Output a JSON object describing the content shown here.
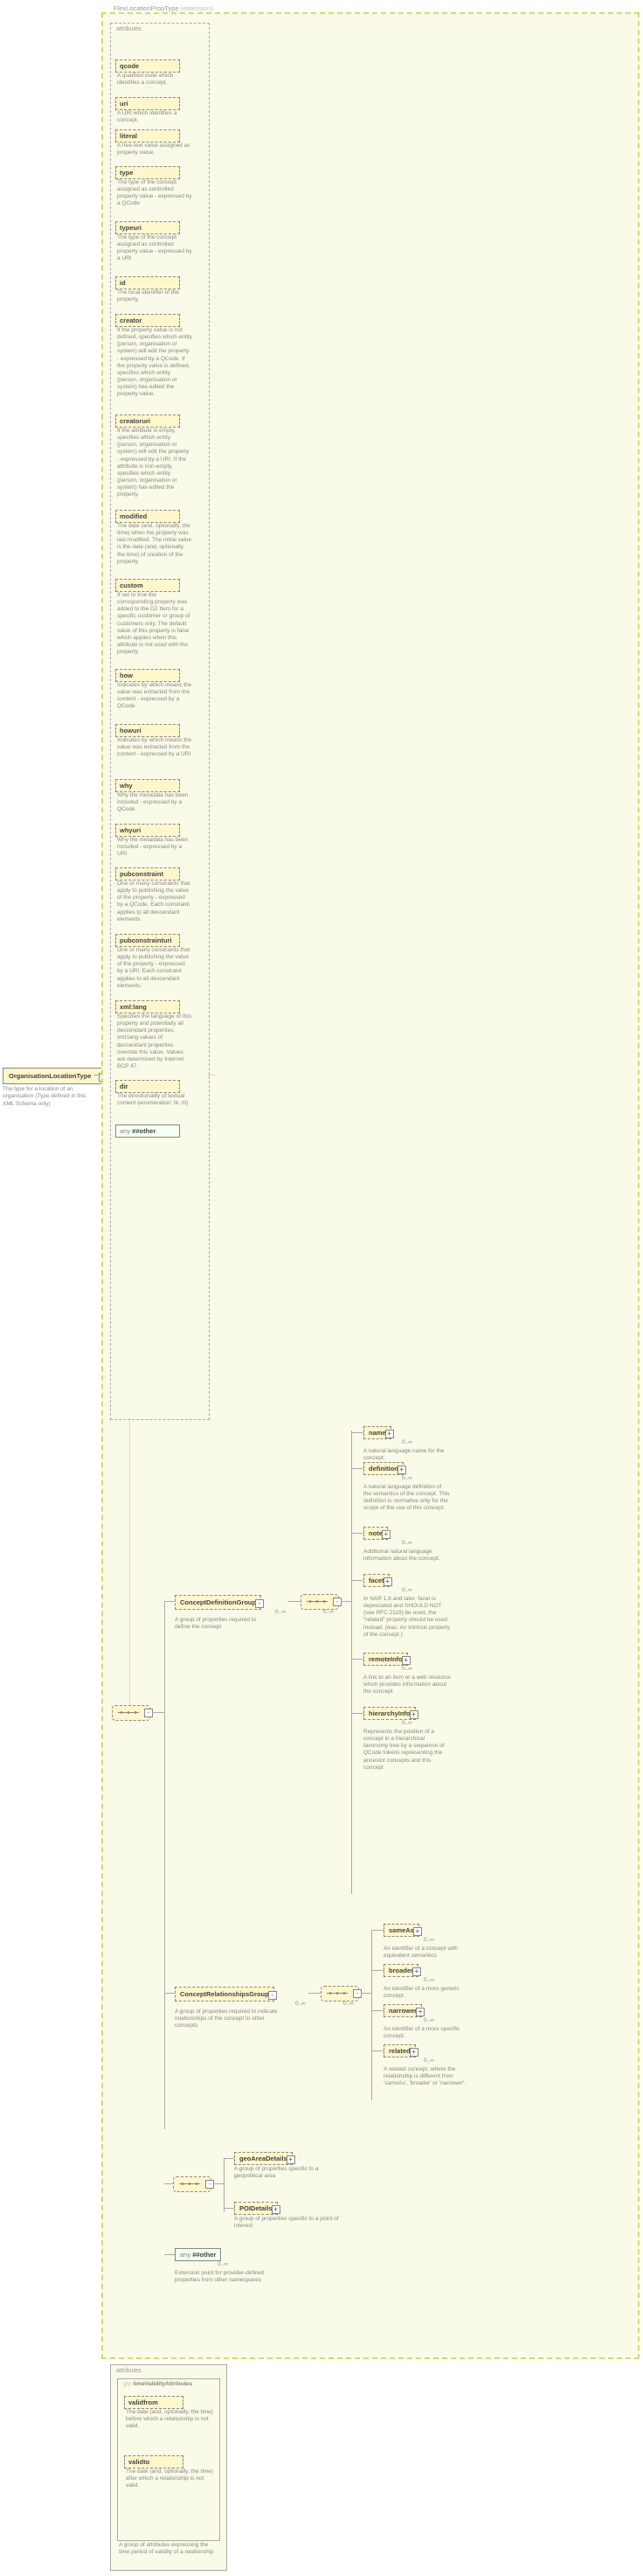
{
  "panel": {
    "title": "FlexLocationPropType",
    "ext": "(extension)"
  },
  "attributes_label": "attributes",
  "root": {
    "name": "OrganisationLocationType",
    "desc": "The type for a location of an organisation (Type defined in this XML Schema only)"
  },
  "attrs": [
    {
      "name": "qcode",
      "desc": "A qualified code which identifies a concept."
    },
    {
      "name": "uri",
      "desc": "A URI which identifies a concept."
    },
    {
      "name": "literal",
      "desc": "A free-text value assigned as property value."
    },
    {
      "name": "type",
      "desc": "The type of the concept assigned as controlled property value - expressed by a QCode"
    },
    {
      "name": "typeuri",
      "desc": "The type of the concept assigned as controlled property value - expressed by a URI"
    },
    {
      "name": "id",
      "desc": "The local identifier of the property."
    },
    {
      "name": "creator",
      "desc": "If the property value is not defined, specifies which entity (person, organisation or system) will edit the property - expressed by a QCode. If the property value is defined, specifies which entity (person, organisation or system) has edited the property value."
    },
    {
      "name": "creatoruri",
      "desc": "If the attribute is empty, specifies which entity (person, organisation or system) will edit the property - expressed by a URI. If the attribute is non-empty, specifies which entity (person, organisation or system) has edited the property."
    },
    {
      "name": "modified",
      "desc": "The date (and, optionally, the time) when the property was last modified. The initial value is the date (and, optionally, the time) of creation of the property."
    },
    {
      "name": "custom",
      "desc": "If set to true the corresponding property was added to the G2 Item for a specific customer or group of customers only. The default value of this property is false which applies when this attribute is not used with the property."
    },
    {
      "name": "how",
      "desc": "Indicates by which means the value was extracted from the content - expressed by a QCode"
    },
    {
      "name": "howuri",
      "desc": "Indicates by which means the value was extracted from the content - expressed by a URI"
    },
    {
      "name": "why",
      "desc": "Why the metadata has been included - expressed by a QCode"
    },
    {
      "name": "whyuri",
      "desc": "Why the metadata has been included - expressed by a URI"
    },
    {
      "name": "pubconstraint",
      "desc": "One or many constraints that apply to publishing the value of the property - expressed by a QCode. Each constraint applies to all descendant elements."
    },
    {
      "name": "pubconstrainturi",
      "desc": "One or many constraints that apply to publishing the value of the property - expressed by a URI. Each constraint applies to all descendant elements."
    },
    {
      "name": "xml:lang",
      "desc": "Specifies the language of this property and potentially all descendant properties. xml:lang values of descendant properties override this value. Values are determined by Internet BCP 47."
    },
    {
      "name": "dir",
      "desc": "The directionality of textual content (enumeration: ltr, rtl)"
    }
  ],
  "any_other": "##other",
  "groups": {
    "cdg": {
      "name": "ConceptDefinitionGroup",
      "desc": "A group of properties required to define the concept"
    },
    "crg": {
      "name": "ConceptRelationshipsGroup",
      "desc": "A group of properties required to indicate relationships of the concept to other concepts"
    }
  },
  "cdg_elems": [
    {
      "name": "name",
      "occ": "0..∞",
      "desc": "A natural language name for the concept."
    },
    {
      "name": "definition",
      "occ": "0..∞",
      "desc": "A natural language definition of the semantics of the concept. This definition is normative only for the scope of the use of this concept."
    },
    {
      "name": "note",
      "occ": "0..∞",
      "desc": "Additional natural language information about the concept."
    },
    {
      "name": "facet",
      "occ": "0..∞",
      "desc": "In NAR 1.8 and later, facet is deprecated and SHOULD NOT (see RFC 2119) be used, the \"related\" property should be used instead. (was: An intrinsic property of the concept.)"
    },
    {
      "name": "remoteInfo",
      "occ": "0..∞",
      "desc": "A link to an item or a web resource which provides information about the concept"
    },
    {
      "name": "hierarchyInfo",
      "occ": "0..∞",
      "desc": "Represents the position of a concept in a hierarchical taxonomy tree by a sequence of QCode tokens representing the ancestor concepts and this concept"
    }
  ],
  "crg_elems": [
    {
      "name": "sameAs",
      "occ": "0..∞",
      "desc": "An identifier of a concept with equivalent semantics"
    },
    {
      "name": "broader",
      "occ": "0..∞",
      "desc": "An identifier of a more generic concept."
    },
    {
      "name": "narrower",
      "occ": "0..∞",
      "desc": "An identifier of a more specific concept."
    },
    {
      "name": "related",
      "occ": "0..∞",
      "desc": "A related concept, where the relationship is different from 'sameAs', 'broader' or 'narrower'."
    }
  ],
  "tail_groups": [
    {
      "name": "geoAreaDetails",
      "desc": "A group of properties specific to a geopolitical area"
    },
    {
      "name": "POIDetails",
      "desc": "A group of properties specific to a point of interest"
    }
  ],
  "any_elem": {
    "label": "##other",
    "occ": "0..∞",
    "desc": "Extension point for provider-defined properties from other namespaces"
  },
  "time_group": {
    "title": "timeValidityAttributes",
    "attrs": [
      {
        "name": "validfrom",
        "desc": "The date (and, optionally, the time) before which a relationship is not valid."
      },
      {
        "name": "validto",
        "desc": "The date (and, optionally, the time) after which a relationship is not valid."
      }
    ],
    "desc": "A group of attributes expressing the time period of validity of a relationship"
  },
  "any_label": "any",
  "grp_label": "grp"
}
